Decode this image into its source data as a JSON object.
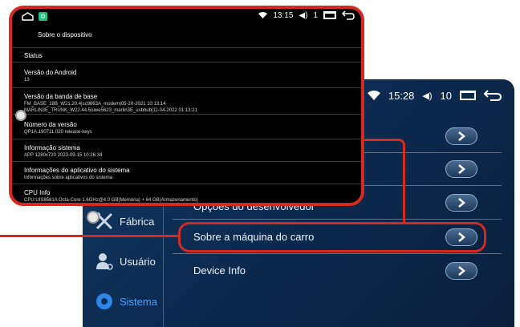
{
  "car": {
    "status": {
      "time": "15:28",
      "volume": "10"
    },
    "rows": [
      {
        "label": ""
      },
      {
        "label": ""
      },
      {
        "label": "Opções do desenvolvedor"
      },
      {
        "label": "Sobre a máquina do carro"
      },
      {
        "label": "Device Info"
      }
    ],
    "sidebar": [
      {
        "label": "Fábrica",
        "icon": "tools-icon"
      },
      {
        "label": "Usuário",
        "icon": "user-gear-icon"
      },
      {
        "label": "Sistema",
        "icon": "settings-gear-icon"
      }
    ]
  },
  "phone": {
    "status": {
      "time": "13:15",
      "volume": "1"
    },
    "header": "Sobre o dispositivo",
    "items": [
      {
        "title": "Status",
        "sub": ""
      },
      {
        "title": "Versão do Android",
        "sub": "13"
      },
      {
        "title": "Versão da banda de base",
        "sub": "FM_BASE_18B_W21.20.4|sc9863A_modem|05-20-2021 10:13:14",
        "sub2": "MARLIN3E_TRUNK_W22.44.5|uwe5623_marlin3E_usbhub|11-04-2022 01:13:21"
      },
      {
        "title": "Número da versão",
        "sub": "QP1A.190711.020 release-keys"
      },
      {
        "title": "Informação sistema",
        "sub": "APP 1280x720 2023-09-15 10:26:34"
      },
      {
        "title": "Informações do aplicativo do sistema",
        "sub": "Informações sobre aplicativos do sistema"
      },
      {
        "title": "CPU Info",
        "sub": "CPU:UIS8581A Octa-Core 1.6GHz@4.0 GB(Memória) + 64 GB(Armazenamento)"
      }
    ]
  },
  "colors": {
    "accent": "#d42a22",
    "active": "#4aa3ff"
  }
}
